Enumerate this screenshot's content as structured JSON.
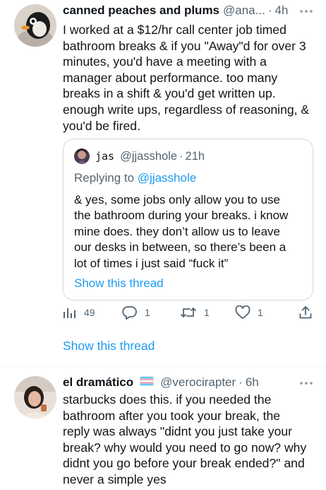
{
  "tweet1": {
    "display_name": "canned peaches and plums",
    "handle": "@ana...",
    "separator": "·",
    "time": "4h",
    "more_icon": "more-dots-icon",
    "lines": [
      "I worked at a $12/hr call center job timed",
      "bathroom breaks & if you \"Away\"d for over 3",
      "minutes, you'd have a meeting with a",
      "manager about performance. too many",
      "breaks in a shift & you'd get written up.",
      "enough write ups, regardless of reasoning, &",
      "you'd be fired."
    ],
    "quoted": {
      "display_name": "jas",
      "handle": "@jjasshole",
      "separator": "·",
      "time": "21h",
      "replying_prefix": "Replying to ",
      "replying_handle": "@jjasshole",
      "lines": [
        "& yes, some jobs only allow you to use",
        "the bathroom during your breaks. i know",
        "mine does. they don’t allow us to leave",
        "our desks in between, so there’s been a",
        "lot of times i just said “fuck it”"
      ],
      "show_thread": "Show this thread"
    },
    "actions": {
      "views": "49",
      "replies": "1",
      "retweets": "1",
      "likes": "1"
    },
    "show_thread": "Show this thread"
  },
  "tweet2": {
    "display_name": "el dramático",
    "flag_icon": "transgender-flag-icon",
    "handle": "@verocirapter",
    "separator": "·",
    "time": "6h",
    "lines": [
      "starbucks does this. if you needed the",
      "bathroom after you took your break, the",
      "reply was always \"didnt you just take your",
      "break? why would you need to go now? why",
      "didnt you go before your break ended?\" and",
      "never a simple yes"
    ]
  },
  "colors": {
    "link": "#1d9bf0",
    "secondary_text": "#536471",
    "border": "#cfd9de"
  }
}
